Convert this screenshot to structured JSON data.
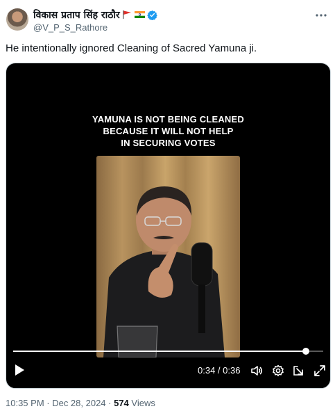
{
  "author": {
    "display_name": "विकास प्रताप सिंह राठौर",
    "handle": "@V_P_S_Rathore"
  },
  "tweet": {
    "text": "He intentionally ignored Cleaning of Sacred Yamuna ji."
  },
  "video": {
    "caption_lines": [
      "YAMUNA IS NOT BEING CLEANED",
      "BECAUSE IT WILL NOT HELP",
      "IN SECURING VOTES"
    ],
    "time_display": "0:34 / 0:36",
    "progress": 0.944
  },
  "meta": {
    "timestamp": "10:35 PM · Dec 28, 2024",
    "separator": " · ",
    "views_count": "574",
    "views_label": "Views"
  },
  "icons": {
    "verified": "verified-badge-icon",
    "more": "more-options-icon",
    "play": "play-icon",
    "volume": "volume-icon",
    "settings": "settings-icon",
    "popout": "popout-icon",
    "fullscreen": "fullscreen-icon"
  },
  "colors": {
    "verified_blue": "#1d9bf0",
    "secondary_text": "#536471",
    "primary_text": "#0f1419"
  }
}
